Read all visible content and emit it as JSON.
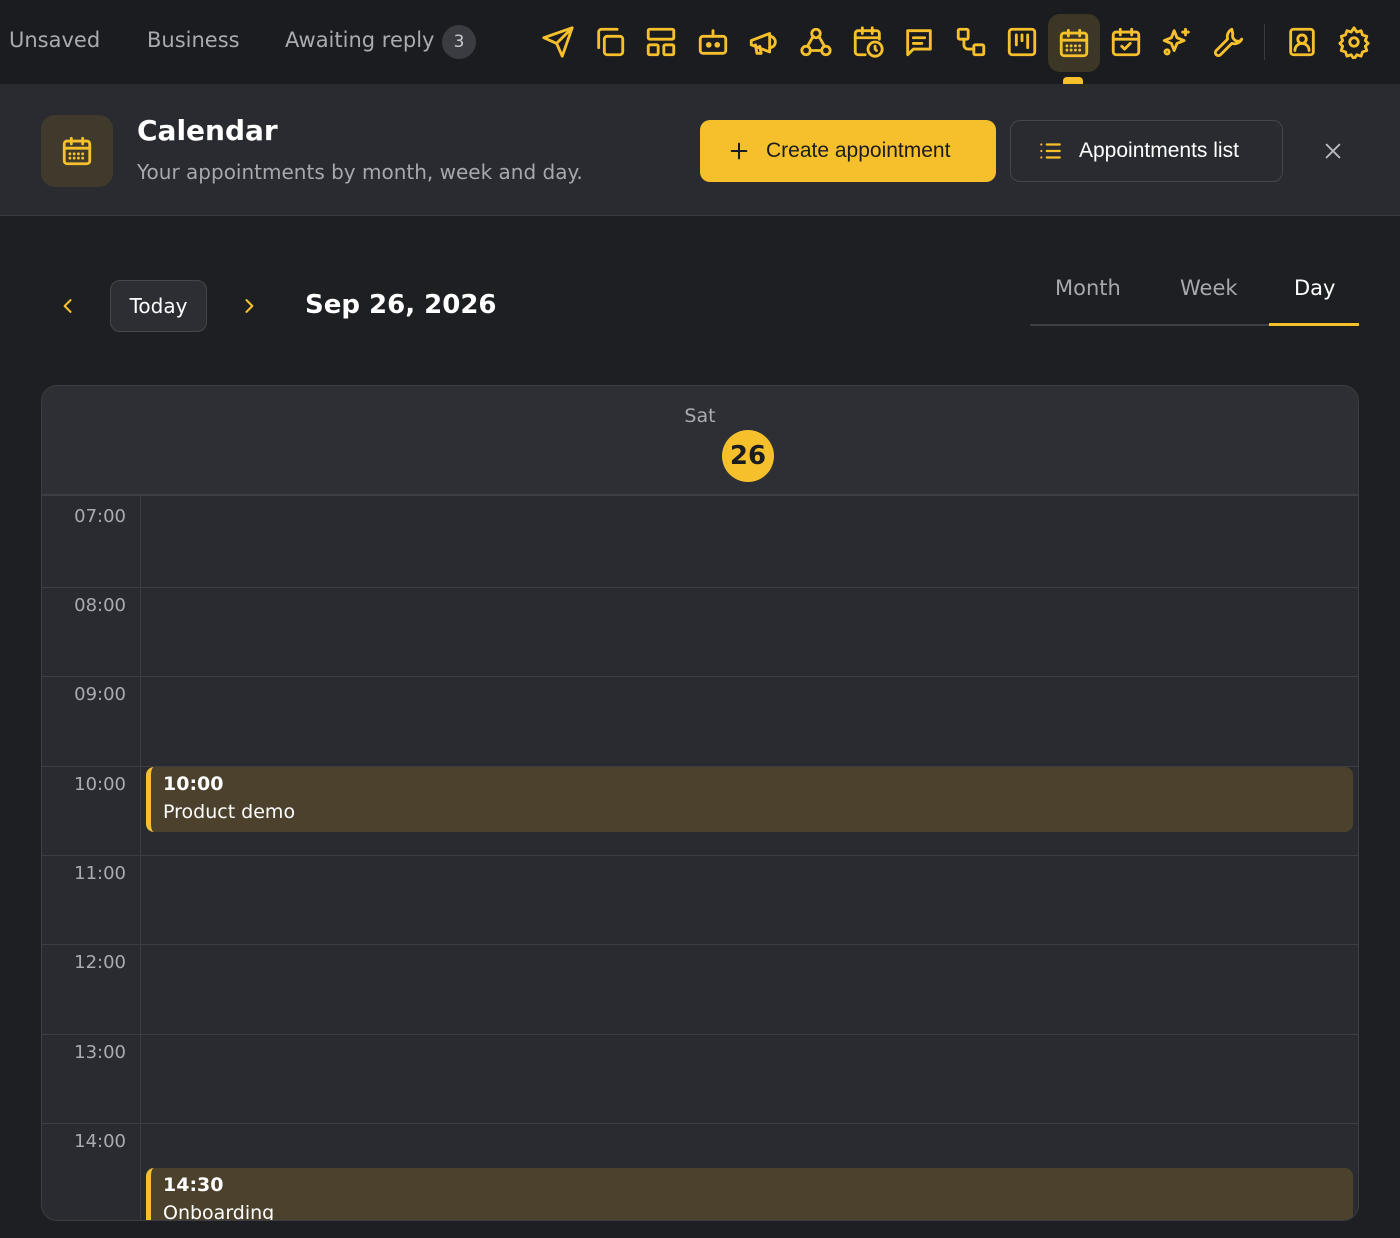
{
  "topbar": {
    "tabs": [
      "Unsaved",
      "Business",
      "Awaiting reply"
    ],
    "badge": "3",
    "icons": [
      "send-icon",
      "copy-icon",
      "layout-icon",
      "robot-icon",
      "megaphone-icon",
      "webhook-icon",
      "calendar-clock-icon",
      "message-icon",
      "flow-icon",
      "kanban-icon",
      "calendar-icon",
      "calendar-check-icon",
      "sparkles-icon",
      "wrench-icon",
      "contact-icon",
      "gear-icon"
    ],
    "active_icon": "calendar-icon"
  },
  "header": {
    "title": "Calendar",
    "subtitle": "Your appointments by month, week and day.",
    "create_label": "Create appointment",
    "list_label": "Appointments list"
  },
  "nav": {
    "today_label": "Today",
    "current_date": "Sep 26, 2026",
    "views": [
      "Month",
      "Week",
      "Day"
    ],
    "selected_view": "Day"
  },
  "day": {
    "weekday": "Sat",
    "day_number": "26",
    "hours": [
      "07:00",
      "08:00",
      "09:00",
      "10:00",
      "11:00",
      "12:00",
      "13:00",
      "14:00"
    ]
  },
  "events": [
    {
      "time": "10:00",
      "title": "Product demo"
    },
    {
      "time": "14:30",
      "title": "Onboarding"
    }
  ],
  "colors": {
    "accent": "#f6c02d",
    "background": "#1e1f22",
    "panel": "#2a2b30"
  }
}
